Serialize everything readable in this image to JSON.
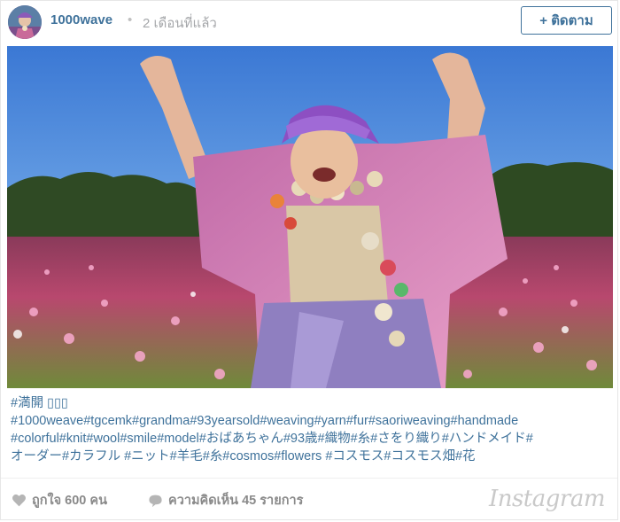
{
  "header": {
    "username": "1000wave",
    "separator": "•",
    "time_ago": "2 เดือนที่แล้ว",
    "follow_label": "+ ติดตาม"
  },
  "caption": {
    "lines": [
      "#満開 ▯▯▯",
      "#1000weave#tgcemk#grandma#93yearsold#weaving#yarn#fur#saoriweaving#handmade",
      "#colorful#knit#wool#smile#model#おばあちゃん#93歳#織物#糸#さをり織り#ハンドメイド#",
      "オーダー#カラフル #ニット#羊毛#糸#cosmos#flowers #コスモス#コスモス畑#花"
    ]
  },
  "footer": {
    "likes_label": "ถูกใจ 600 คน",
    "comments_label": "ความคิดเห็น 45 รายการ",
    "brand": "Instagram"
  },
  "colors": {
    "link": "#3f729b",
    "muted": "#8a8a8a",
    "border": "#e6e6e6"
  },
  "icons": {
    "like": "heart-icon",
    "comment": "speech-bubble-icon"
  }
}
